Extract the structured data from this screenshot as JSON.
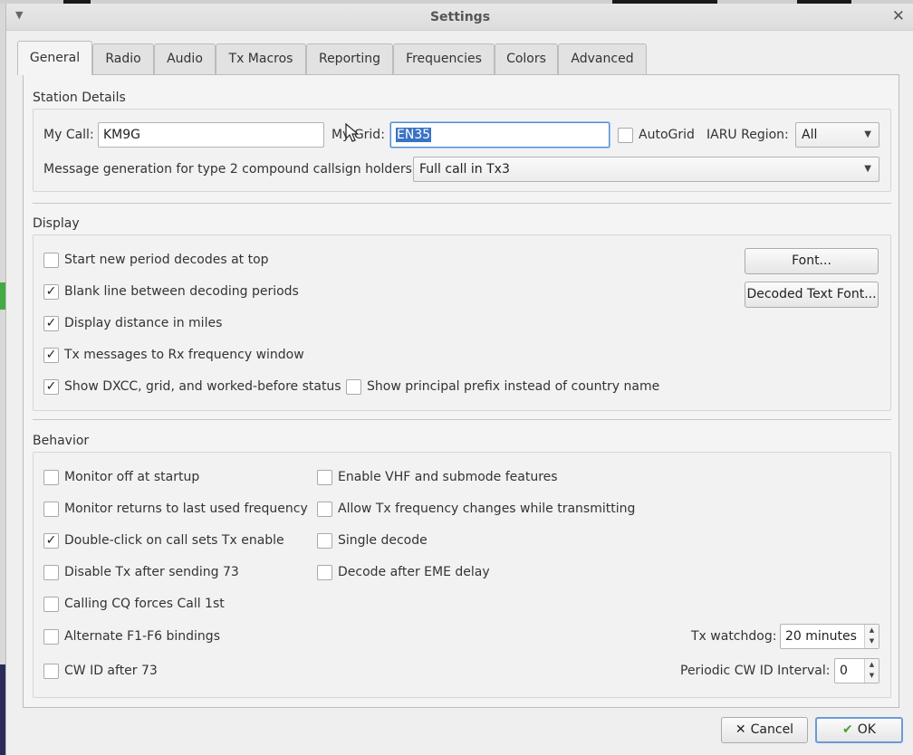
{
  "window": {
    "title": "Settings",
    "close_icon": "close-icon",
    "menu_icon": "window-menu-icon"
  },
  "tabs": [
    {
      "label": "General",
      "active": true
    },
    {
      "label": "Radio"
    },
    {
      "label": "Audio"
    },
    {
      "label": "Tx Macros"
    },
    {
      "label": "Reporting"
    },
    {
      "label": "Frequencies"
    },
    {
      "label": "Colors"
    },
    {
      "label": "Advanced"
    }
  ],
  "station": {
    "title": "Station Details",
    "my_call_label": "My Call:",
    "my_call_value": "KM9G",
    "my_grid_label": "My Grid:",
    "my_grid_value": "EN35",
    "autogrid_label": "AutoGrid",
    "autogrid_checked": false,
    "iaru_label": "IARU Region:",
    "iaru_value": "All",
    "msg_gen_label": "Message generation for type 2 compound callsign holders:",
    "msg_gen_value": "Full call in Tx3"
  },
  "display": {
    "title": "Display",
    "options": [
      {
        "label": "Start new period decodes at top",
        "checked": false
      },
      {
        "label": "Blank line between decoding periods",
        "checked": true
      },
      {
        "label": "Display distance in miles",
        "checked": true
      },
      {
        "label": "Tx messages to Rx frequency window",
        "checked": true
      },
      {
        "label": "Show DXCC, grid, and worked-before status",
        "checked": true
      }
    ],
    "principal_prefix": {
      "label": "Show principal prefix instead of country name",
      "checked": false
    },
    "font_button": "Font...",
    "decoded_font_button": "Decoded Text Font..."
  },
  "behavior": {
    "title": "Behavior",
    "left_options": [
      {
        "label": "Monitor off at startup",
        "checked": false
      },
      {
        "label": "Monitor returns to last used frequency",
        "checked": false
      },
      {
        "label": "Double-click on call sets Tx enable",
        "checked": true
      },
      {
        "label": "Disable Tx after sending 73",
        "checked": false
      },
      {
        "label": "Calling CQ forces Call 1st",
        "checked": false
      },
      {
        "label": "Alternate F1-F6 bindings",
        "checked": false
      },
      {
        "label": "CW ID after 73",
        "checked": false
      }
    ],
    "right_options": [
      {
        "label": "Enable VHF and submode features",
        "checked": false
      },
      {
        "label": "Allow Tx frequency changes while transmitting",
        "checked": false
      },
      {
        "label": "Single decode",
        "checked": false
      },
      {
        "label": "Decode after EME delay",
        "checked": false
      }
    ],
    "tx_watchdog_label": "Tx watchdog:",
    "tx_watchdog_value": "20 minutes",
    "cwid_interval_label": "Periodic CW ID Interval:",
    "cwid_interval_value": "0"
  },
  "buttons": {
    "cancel": "Cancel",
    "ok": "OK"
  },
  "check_mark": "✓"
}
